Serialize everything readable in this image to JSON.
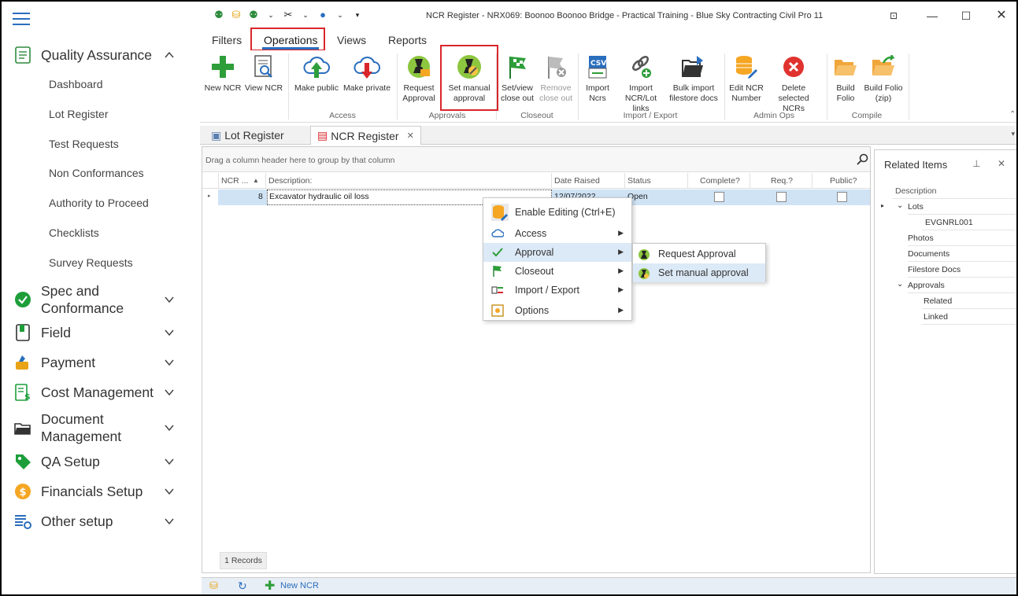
{
  "window": {
    "title": "NCR Register - NRX069: Boonoo Boonoo Bridge - Practical Training - Blue Sky Contracting Civil Pro 11"
  },
  "sidebar": {
    "groups": [
      {
        "label": "Quality Assurance",
        "icon": "qa-icon"
      },
      {
        "label": "Spec and Conformance",
        "icon": "check-circle-icon"
      },
      {
        "label": "Field",
        "icon": "field-icon"
      },
      {
        "label": "Payment",
        "icon": "payment-icon"
      },
      {
        "label": "Cost Management",
        "icon": "cost-icon"
      },
      {
        "label": "Document Management",
        "icon": "folder-icon"
      },
      {
        "label": "QA Setup",
        "icon": "tag-icon"
      },
      {
        "label": "Financials Setup",
        "icon": "dollar-icon"
      },
      {
        "label": "Other setup",
        "icon": "settings-list-icon"
      }
    ],
    "qa_items": [
      "Dashboard",
      "Lot Register",
      "Test Requests",
      "Non Conformances",
      "Authority to Proceed",
      "Checklists",
      "Survey Requests"
    ],
    "spec_line1": "Spec and",
    "spec_line2": "Conformance",
    "doc_line1": "Document",
    "doc_line2": "Management"
  },
  "ribbon": {
    "tabs": [
      "Filters",
      "Operations",
      "Views",
      "Reports"
    ],
    "active_tab": "Operations",
    "buttons": {
      "new_ncr": "New NCR",
      "view_ncr": "View NCR",
      "make_public": "Make public",
      "make_private": "Make private",
      "request_approval_1": "Request",
      "request_approval_2": "Approval",
      "set_manual_1": "Set manual",
      "set_manual_2": "approval",
      "setview_1": "Set/view",
      "setview_2": "close out",
      "remove_1": "Remove",
      "remove_2": "close out",
      "import_1": "Import",
      "import_2": "Ncrs",
      "import_links_1": "Import",
      "import_links_2": "NCR/Lot links",
      "bulk_1": "Bulk import",
      "bulk_2": "filestore docs",
      "edit_1": "Edit NCR",
      "edit_2": "Number",
      "delete_1": "Delete",
      "delete_2": "selected NCRs",
      "build_1": "Build",
      "build_2": "Folio",
      "buildzip_1": "Build Folio",
      "buildzip_2": "(zip)",
      "csv": "CSV"
    },
    "groups": {
      "access": "Access",
      "approvals": "Approvals",
      "closeout": "Closeout",
      "import_export": "Import / Export",
      "admin": "Admin Ops",
      "compile": "Compile"
    }
  },
  "doc_tabs": [
    {
      "label": "Lot Register"
    },
    {
      "label": "NCR Register"
    }
  ],
  "grid": {
    "group_hint": "Drag a column header here to group by that column",
    "columns": [
      "NCR ...",
      "Description:",
      "Date Raised",
      "Status",
      "Complete?",
      "Req.?",
      "Public?"
    ],
    "rows": [
      {
        "ncr": "8",
        "description": "Excavator hydraulic oil loss",
        "date": "12/07/2022",
        "status": "Open"
      }
    ],
    "records": "1 Records"
  },
  "related": {
    "title": "Related Items",
    "column": "Description",
    "tree": {
      "lots": "Lots",
      "lot_item": "EVGNRL001",
      "photos": "Photos",
      "documents": "Documents",
      "filestore": "Filestore Docs",
      "approvals": "Approvals",
      "related": "Related",
      "linked": "Linked"
    }
  },
  "context_menu": {
    "items": [
      "Enable Editing (Ctrl+E)",
      "Access",
      "Approval",
      "Closeout",
      "Import / Export",
      "Options"
    ],
    "submenu": [
      "Request Approval",
      "Set manual approval"
    ]
  },
  "bottom": {
    "new_ncr": "New NCR"
  },
  "colors": {
    "accent": "#2a6ebd",
    "highlight_box": "#d9262b",
    "selected_row": "#cfe3f5"
  }
}
